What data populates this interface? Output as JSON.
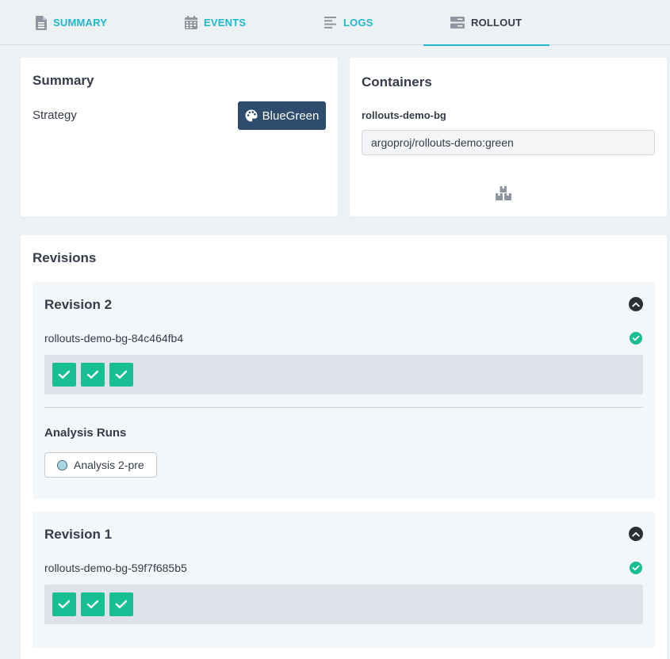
{
  "tabs": [
    {
      "label": "SUMMARY",
      "icon": "file-icon",
      "active": false
    },
    {
      "label": "EVENTS",
      "icon": "calendar-icon",
      "active": false
    },
    {
      "label": "LOGS",
      "icon": "align-left-icon",
      "active": false
    },
    {
      "label": "ROLLOUT",
      "icon": "server-icon",
      "active": true
    }
  ],
  "summary": {
    "title": "Summary",
    "strategy_label": "Strategy",
    "strategy_value": "BlueGreen",
    "strategy_icon": "palette-icon"
  },
  "containers": {
    "title": "Containers",
    "name": "rollouts-demo-bg",
    "image": "argoproj/rollouts-demo:green",
    "icon": "cubes-icon"
  },
  "revisions": {
    "title": "Revisions",
    "items": [
      {
        "title": "Revision 2",
        "replicaset": "rollouts-demo-bg-84c464fb4",
        "status": "healthy",
        "pods": [
          "ready",
          "ready",
          "ready"
        ],
        "analysis_title": "Analysis Runs",
        "analysis_runs": [
          "Analysis 2-pre"
        ]
      },
      {
        "title": "Revision 1",
        "replicaset": "rollouts-demo-bg-59f7f685b5",
        "status": "healthy",
        "pods": [
          "ready",
          "ready",
          "ready"
        ]
      }
    ]
  },
  "colors": {
    "accent": "#1fb8c9",
    "strategy_bg": "#2d4c6e",
    "healthy": "#18be94",
    "analysis_dot": "#a9d6e0"
  }
}
